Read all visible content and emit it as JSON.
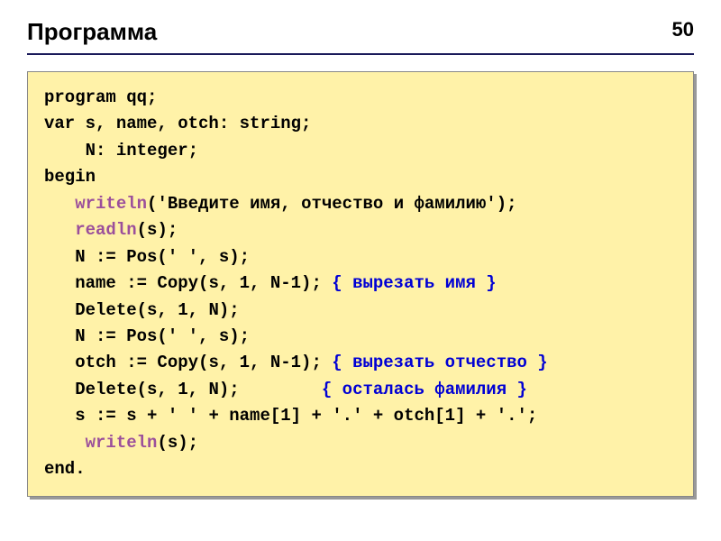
{
  "header": {
    "title": "Программа",
    "page_number": "50"
  },
  "code": {
    "l1": "program qq;",
    "l2": "var s, name, otch: string;",
    "l3_indent": "    ",
    "l3": "N: integer;",
    "l4": "begin",
    "l5_indent": "   ",
    "l5a": "writeln",
    "l5b": "('Введите имя, отчество и фамилию');",
    "l6_indent": "   ",
    "l6a": "readln",
    "l6b": "(s);",
    "l7_indent": "   ",
    "l7": "N := Pos(' ', s);",
    "l8_indent": "   ",
    "l8a": "name := Copy(s, 1, N-1); ",
    "l8b": "{ вырезать имя }",
    "l9_indent": "   ",
    "l9": "Delete(s, 1, N);",
    "l10_indent": "   ",
    "l10": "N := Pos(' ', s);",
    "l11_indent": "   ",
    "l11a": "otch := Copy(s, 1, N-1); ",
    "l11b": "{ вырезать отчество }",
    "l12_indent": "   ",
    "l12a": "Delete(s, 1, N);        ",
    "l12b": "{ осталась фамилия }",
    "l13_indent": "   ",
    "l13": "s := s + ' ' + name[1] + '.' + otch[1] + '.';",
    "l14_indent": "    ",
    "l14a": "writeln",
    "l14b": "(s);",
    "l15": "end."
  }
}
